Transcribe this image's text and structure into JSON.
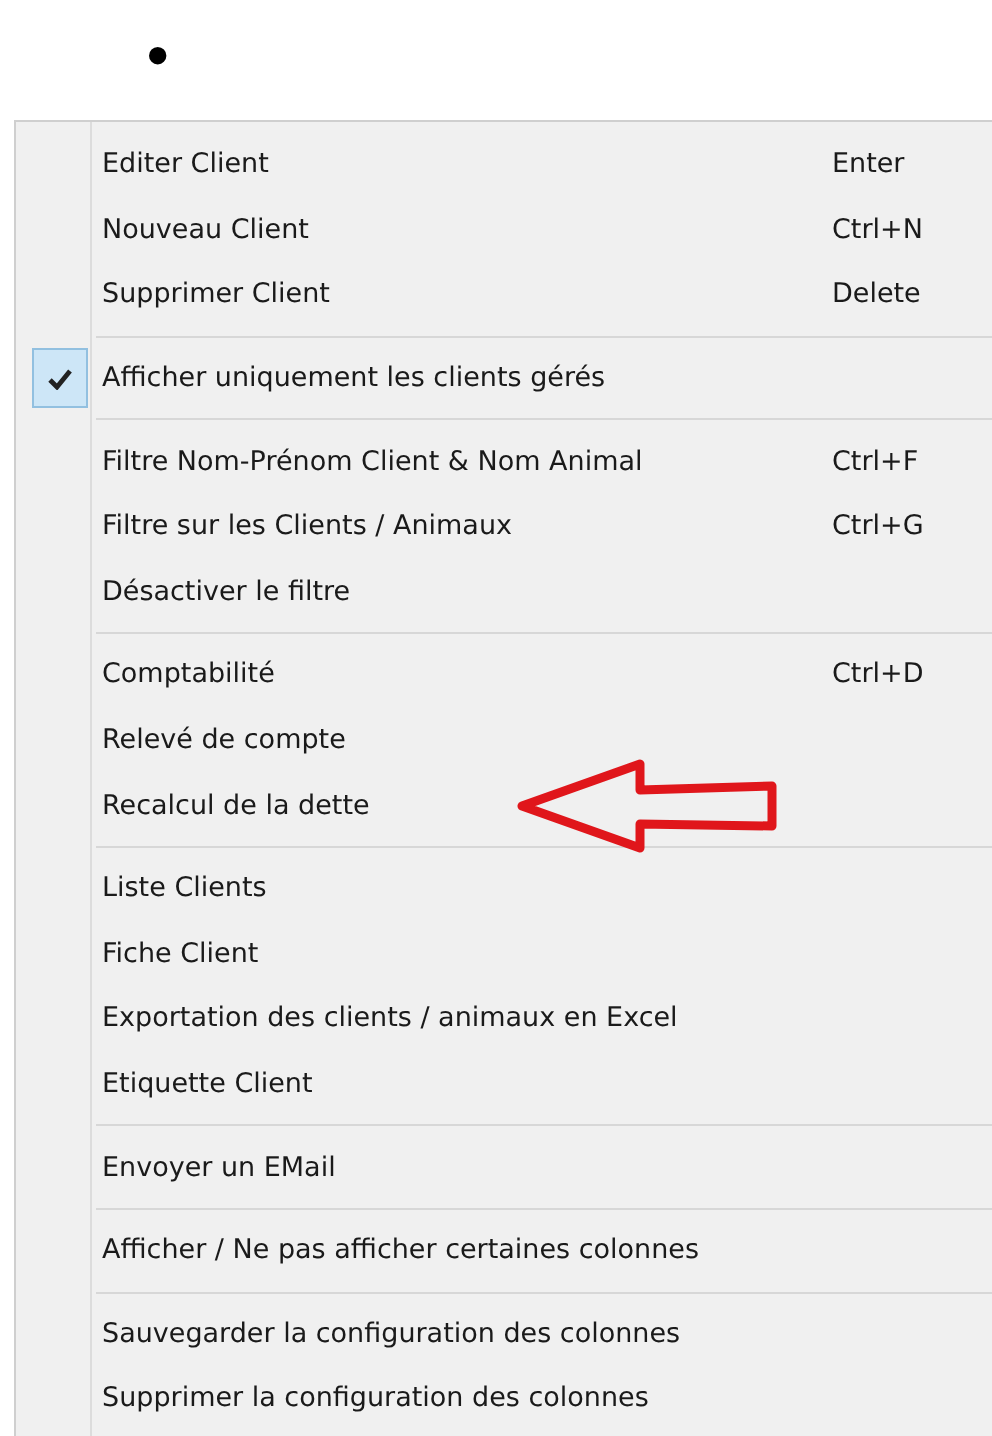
{
  "bullet": "•",
  "menu": {
    "groups": [
      {
        "items": [
          {
            "label": "Editer Client",
            "shortcut": "Enter",
            "checked": false
          },
          {
            "label": "Nouveau Client",
            "shortcut": "Ctrl+N",
            "checked": false
          },
          {
            "label": "Supprimer Client",
            "shortcut": "Delete",
            "checked": false
          }
        ]
      },
      {
        "items": [
          {
            "label": "Afficher uniquement les clients gérés",
            "checked": true
          }
        ]
      },
      {
        "items": [
          {
            "label": "Filtre Nom-Prénom Client & Nom Animal",
            "shortcut": "Ctrl+F",
            "checked": false
          },
          {
            "label": "Filtre sur les Clients / Animaux",
            "shortcut": "Ctrl+G",
            "checked": false
          },
          {
            "label": "Désactiver le filtre",
            "checked": false
          }
        ]
      },
      {
        "items": [
          {
            "label": "Comptabilité",
            "shortcut": "Ctrl+D",
            "checked": false
          },
          {
            "label": "Relevé de compte",
            "checked": false
          },
          {
            "label": "Recalcul de la dette",
            "checked": false,
            "annotated": true
          }
        ]
      },
      {
        "items": [
          {
            "label": "Liste Clients",
            "checked": false
          },
          {
            "label": "Fiche Client",
            "checked": false
          },
          {
            "label": "Exportation des clients / animaux en Excel",
            "checked": false
          },
          {
            "label": "Etiquette Client",
            "checked": false
          }
        ]
      },
      {
        "items": [
          {
            "label": "Envoyer un EMail",
            "checked": false
          }
        ]
      },
      {
        "items": [
          {
            "label": "Afficher / Ne pas afficher certaines colonnes",
            "checked": false
          }
        ]
      },
      {
        "items": [
          {
            "label": "Sauvegarder la configuration des colonnes",
            "checked": false
          },
          {
            "label": "Supprimer la configuration des colonnes",
            "checked": false
          }
        ]
      }
    ]
  }
}
